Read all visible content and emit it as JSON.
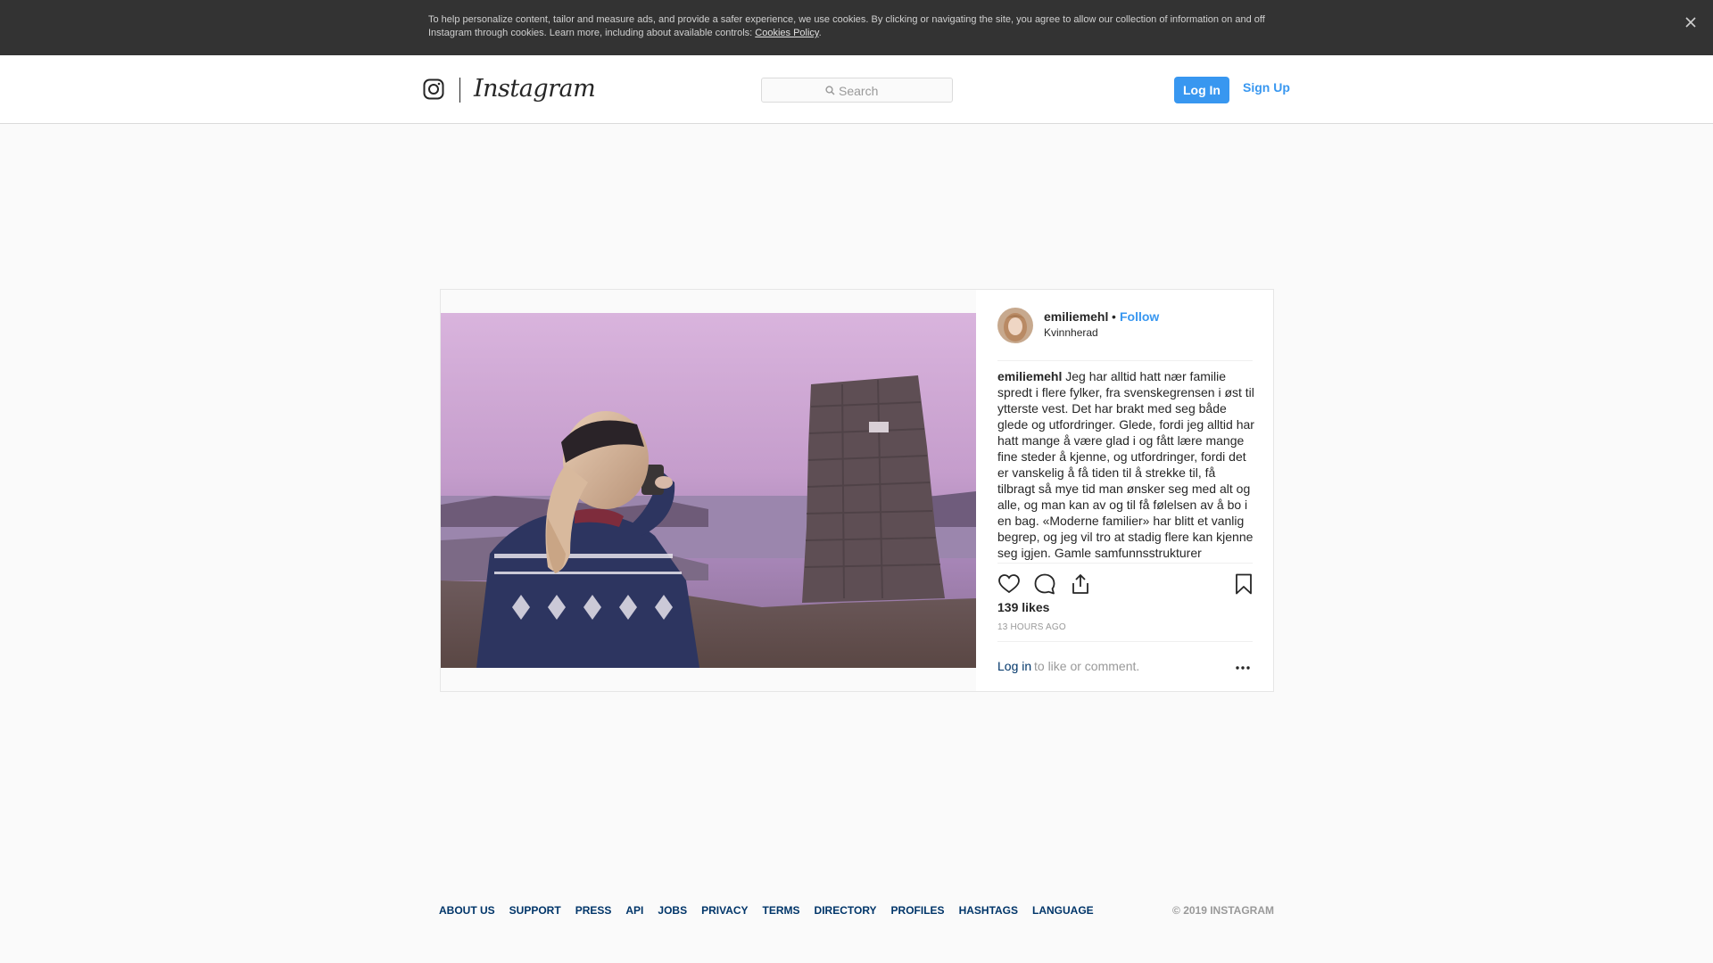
{
  "cookie_banner": {
    "text": "To help personalize content, tailor and measure ads, and provide a safer experience, we use cookies. By clicking or navigating the site, you agree to allow our collection of information on and off Instagram through cookies. Learn more, including about available controls: ",
    "link": "Cookies Policy",
    "trailing": "."
  },
  "nav": {
    "wordmark": "Instagram",
    "search_placeholder": "Search",
    "login_label": "Log In",
    "signup_label": "Sign Up"
  },
  "post": {
    "username": "emiliemehl",
    "separator": "•",
    "follow_label": "Follow",
    "location": "Kvinnherad",
    "caption_user": "emiliemehl",
    "caption_text": "Jeg har alltid hatt nær familie spredt i flere fylker, fra svenskegrensen i øst til ytterste vest. Det har brakt med seg både glede og utfordringer. Glede, fordi jeg alltid har hatt mange å være glad i og fått lære mange fine steder å kjenne, og utfordringer, fordi det er vanskelig å få tiden til å strekke til, få tilbragt så mye tid man ønsker seg med alt og alle, og man kan av og til få følelsen av å bo i en bag. «Moderne familier» har blitt et vanlig begrep, og jeg vil tro at stadig flere kan kjenne seg igjen. Gamle samfunnsstrukturer",
    "likes": "139 likes",
    "time": "13 HOURS AGO",
    "login_link": "Log in",
    "login_rest": "to like or comment.",
    "icons": [
      "heart-icon",
      "comment-icon",
      "share-icon",
      "bookmark-icon",
      "more-icon"
    ]
  },
  "footer": {
    "links": [
      "ABOUT US",
      "SUPPORT",
      "PRESS",
      "API",
      "JOBS",
      "PRIVACY",
      "TERMS",
      "DIRECTORY",
      "PROFILES",
      "HASHTAGS",
      "LANGUAGE"
    ],
    "copyright": "© 2019 INSTAGRAM"
  },
  "colors": {
    "accent": "#3897f0",
    "link_dark": "#003569",
    "cookie_bg": "#333333"
  }
}
